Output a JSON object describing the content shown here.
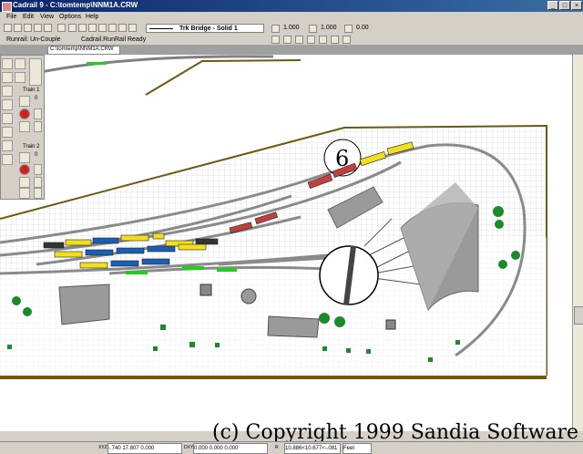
{
  "window": {
    "title": "Cadrail 9 - C:\\tomtemp\\NNM1A.CRW",
    "minimize_label": "_",
    "maximize_label": "□",
    "close_label": "×"
  },
  "menu": {
    "items": [
      {
        "label": "File"
      },
      {
        "label": "Edit"
      },
      {
        "label": "View"
      },
      {
        "label": "Options"
      },
      {
        "label": "Help"
      }
    ]
  },
  "toolbar": {
    "layer_name": "Trk Bridge - Solid 1",
    "value_a": "1.000",
    "value_b": "1.000",
    "value_c": "0.00"
  },
  "status_top": {
    "runrail_state": "Runrail: Un-Couple",
    "ready_text": "Cadrail.RunRail Ready"
  },
  "document": {
    "tab_label": "C:\\tomtemp\\NNM1A.CRW"
  },
  "palette": {
    "train1_label": "Train 1",
    "train1_value": "0",
    "train2_label": "Train 2",
    "train2_value": "0"
  },
  "drawing": {
    "area_number": "6",
    "copyright": "(c) Copyright 1999 Sandia Software"
  },
  "statusbar": {
    "xyz_label": "XYZ",
    "xyz_value": "-.740  17.807  0.000",
    "dxyz_label": "DXYZ",
    "dxyz_value": "0.000  0.000  0.000",
    "rel_label": "R",
    "rel_value": "10.886<10.677<-.081",
    "units": "Feet"
  },
  "colors": {
    "track_gray": "#808080",
    "benchwork_edge": "#6b5a10",
    "car_yellow": "#f0e020",
    "car_blue": "#1a5fb4",
    "car_red": "#c04040",
    "selected_green": "#22cc22",
    "tree_green": "#1a8a2a"
  }
}
